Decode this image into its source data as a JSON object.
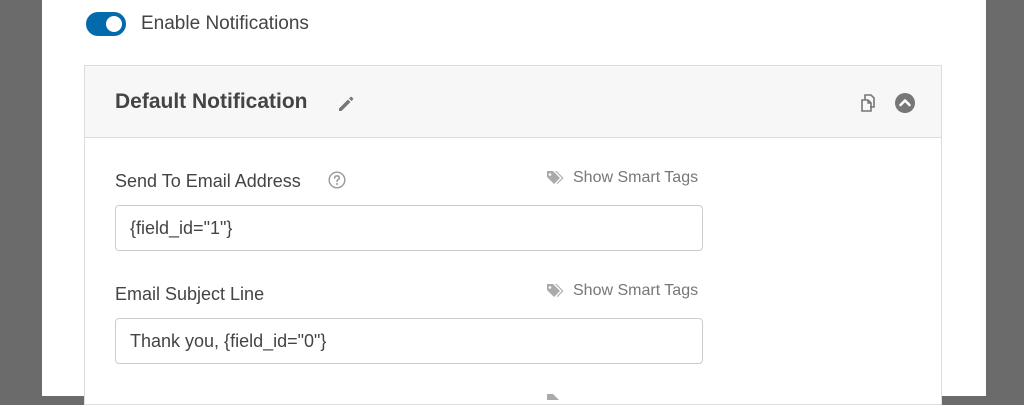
{
  "notifications": {
    "toggle_label": "Enable Notifications",
    "toggle_on": true
  },
  "panel": {
    "title": "Default Notification",
    "icons": [
      "pencil-icon",
      "duplicate-icon",
      "chevron-up-circle-icon"
    ]
  },
  "fields": [
    {
      "label": "Send To Email Address",
      "has_help": true,
      "smart_tags_label": "Show Smart Tags",
      "value": "{field_id=\"1\"}"
    },
    {
      "label": "Email Subject Line",
      "has_help": false,
      "smart_tags_label": "Show Smart Tags",
      "value": "Thank you, {field_id=\"0\"}"
    }
  ],
  "colors": {
    "toggle_on": "#036aab",
    "backdrop": "#6b6b6b",
    "panel_header": "#f7f7f7",
    "text": "#444444",
    "muted": "#777777"
  }
}
